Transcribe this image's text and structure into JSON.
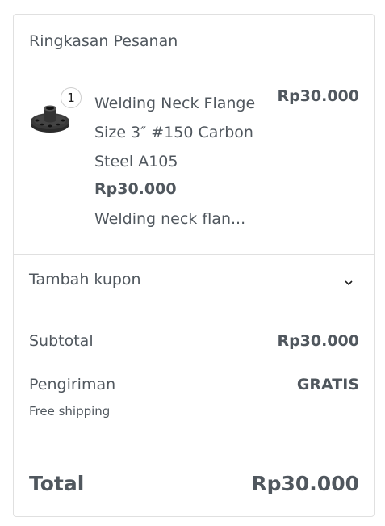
{
  "summary": {
    "title": "Ringkasan Pesanan"
  },
  "item": {
    "quantity": "1",
    "image_icon": "pipe-flange-icon",
    "name_lines": [
      "Welding Neck Flange",
      "Size 3″ #150 Carbon",
      "Steel A105"
    ],
    "unit_price": "Rp30.000",
    "description": "Welding neck flan...",
    "line_total": "Rp30.000"
  },
  "coupon": {
    "label": "Tambah kupon",
    "icon": "chevron-down-icon"
  },
  "totals": {
    "subtotal_label": "Subtotal",
    "subtotal_value": "Rp30.000",
    "shipping_label": "Pengiriman",
    "shipping_value": "GRATIS",
    "shipping_method": "Free shipping",
    "total_label": "Total",
    "total_value": "Rp30.000"
  },
  "colors": {
    "text": "#50575e",
    "border": "#e0e0e0"
  }
}
